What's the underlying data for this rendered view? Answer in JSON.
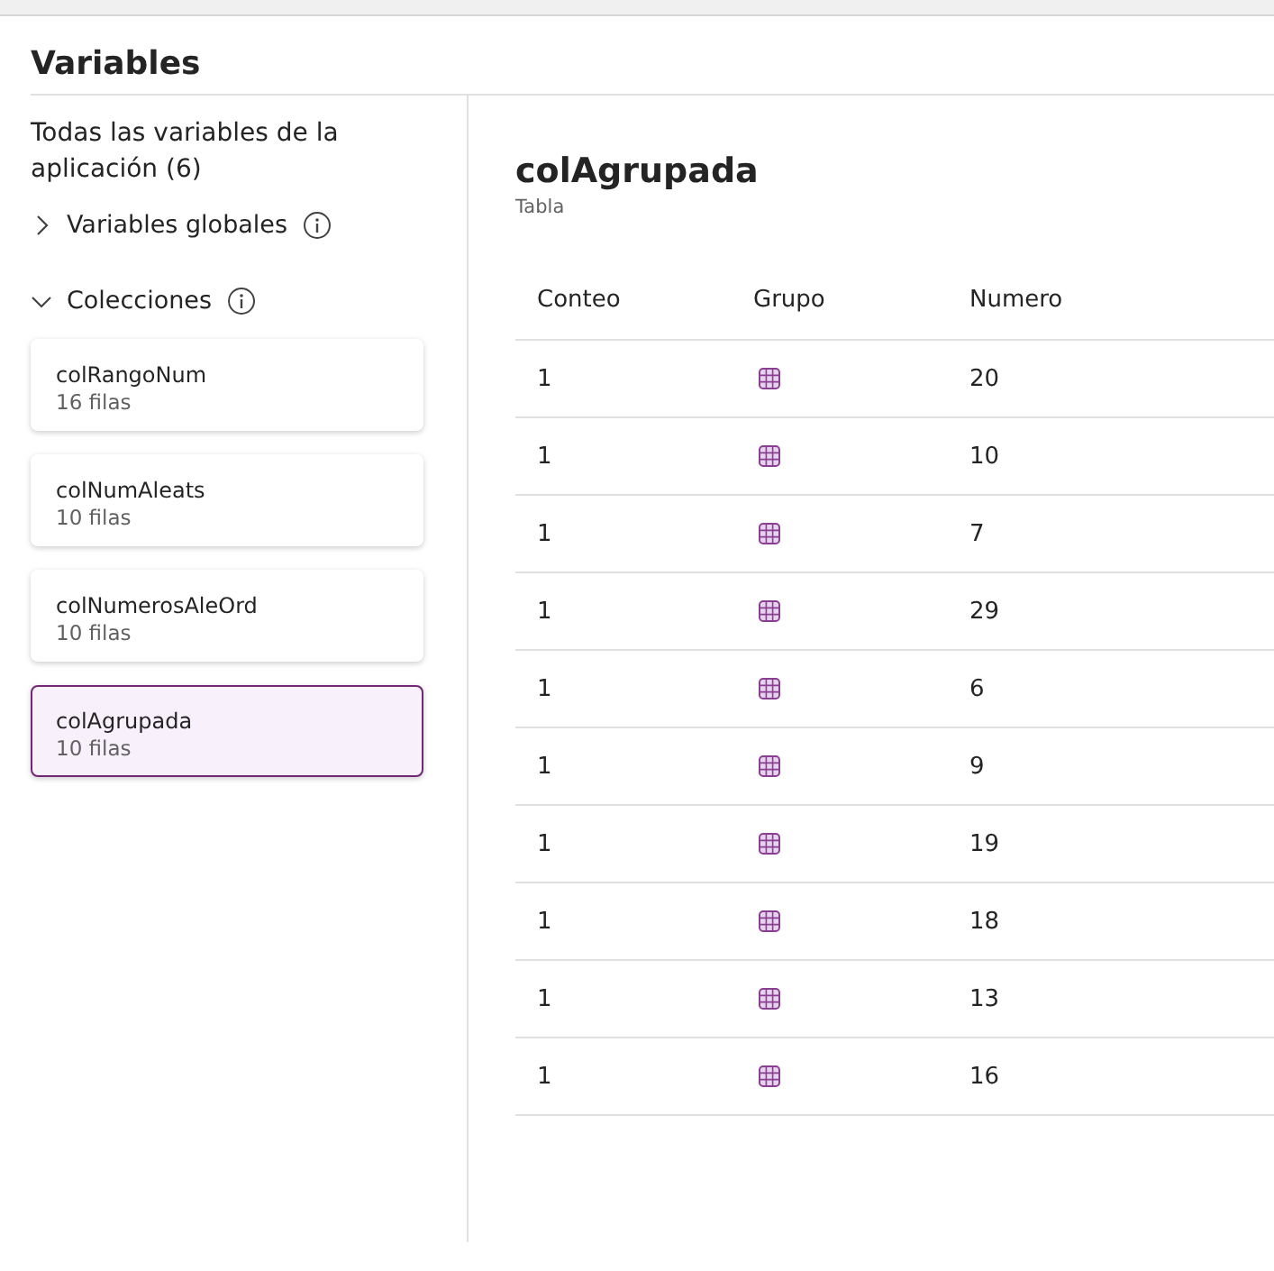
{
  "panel_title": "Variables",
  "sidebar": {
    "heading": "Todas las variables de la aplicación (6)",
    "sections": [
      {
        "label": "Variables globales",
        "expanded": false
      },
      {
        "label": "Colecciones",
        "expanded": true,
        "items": [
          {
            "name": "colRangoNum",
            "rows": "16 filas",
            "selected": false
          },
          {
            "name": "colNumAleats",
            "rows": "10 filas",
            "selected": false
          },
          {
            "name": "colNumerosAleOrd",
            "rows": "10 filas",
            "selected": false
          },
          {
            "name": "colAgrupada",
            "rows": "10 filas",
            "selected": true
          }
        ]
      }
    ]
  },
  "detail": {
    "title": "colAgrupada",
    "subtitle": "Tabla",
    "table": {
      "columns": [
        "Conteo",
        "Grupo",
        "Numero"
      ],
      "rows": [
        {
          "conteo": "1",
          "kind": "table",
          "numero": "20"
        },
        {
          "conteo": "1",
          "kind": "table",
          "numero": "10"
        },
        {
          "conteo": "1",
          "kind": "table",
          "numero": "7"
        },
        {
          "conteo": "1",
          "kind": "table",
          "numero": "29"
        },
        {
          "conteo": "1",
          "kind": "table",
          "numero": "6"
        },
        {
          "conteo": "1",
          "kind": "table",
          "numero": "9"
        },
        {
          "conteo": "1",
          "kind": "table",
          "numero": "19"
        },
        {
          "conteo": "1",
          "kind": "table",
          "numero": "18"
        },
        {
          "conteo": "1",
          "kind": "table",
          "numero": "13"
        },
        {
          "conteo": "1",
          "kind": "table",
          "numero": "16"
        }
      ]
    }
  }
}
